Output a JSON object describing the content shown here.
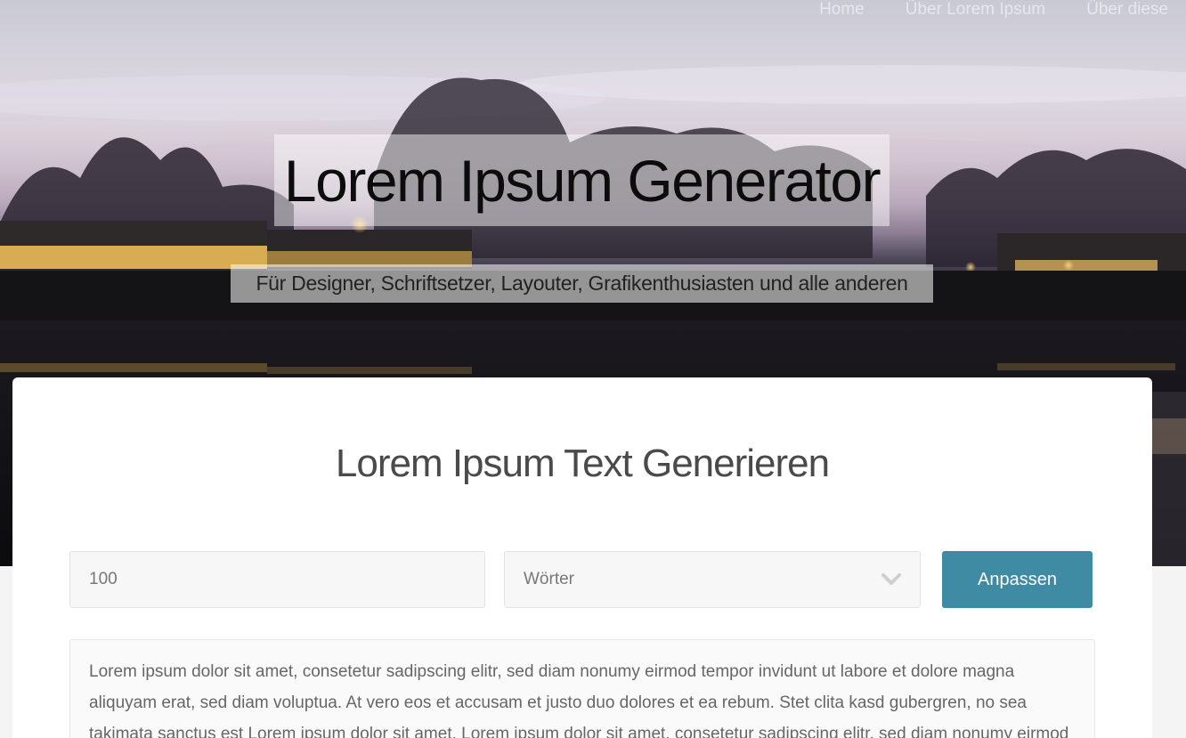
{
  "nav": {
    "items": [
      {
        "label": "Home"
      },
      {
        "label": "Über Lorem Ipsum"
      },
      {
        "label": "Über diese"
      }
    ]
  },
  "hero": {
    "title": "Lorem Ipsum Generator",
    "subtitle": "Für Designer, Schriftsetzer, Layouter, Grafikenthusiasten und alle anderen"
  },
  "generator": {
    "heading": "Lorem Ipsum Text Generieren",
    "count_value": "100",
    "unit_selected": "Wörter",
    "submit_label": "Anpassen",
    "output_text": "Lorem ipsum dolor sit amet, consetetur sadipscing elitr, sed diam nonumy eirmod tempor invidunt ut labore et dolore magna aliquyam erat, sed diam voluptua. At vero eos et accusam et justo duo dolores et ea rebum. Stet clita kasd gubergren, no sea takimata sanctus est Lorem ipsum dolor sit amet. Lorem ipsum dolor sit amet, consetetur sadipscing elitr, sed diam nonumy eirmod tempor"
  },
  "colors": {
    "accent": "#3e8ba3"
  },
  "icons": {
    "unit_dropdown": "chevron-down-icon"
  }
}
